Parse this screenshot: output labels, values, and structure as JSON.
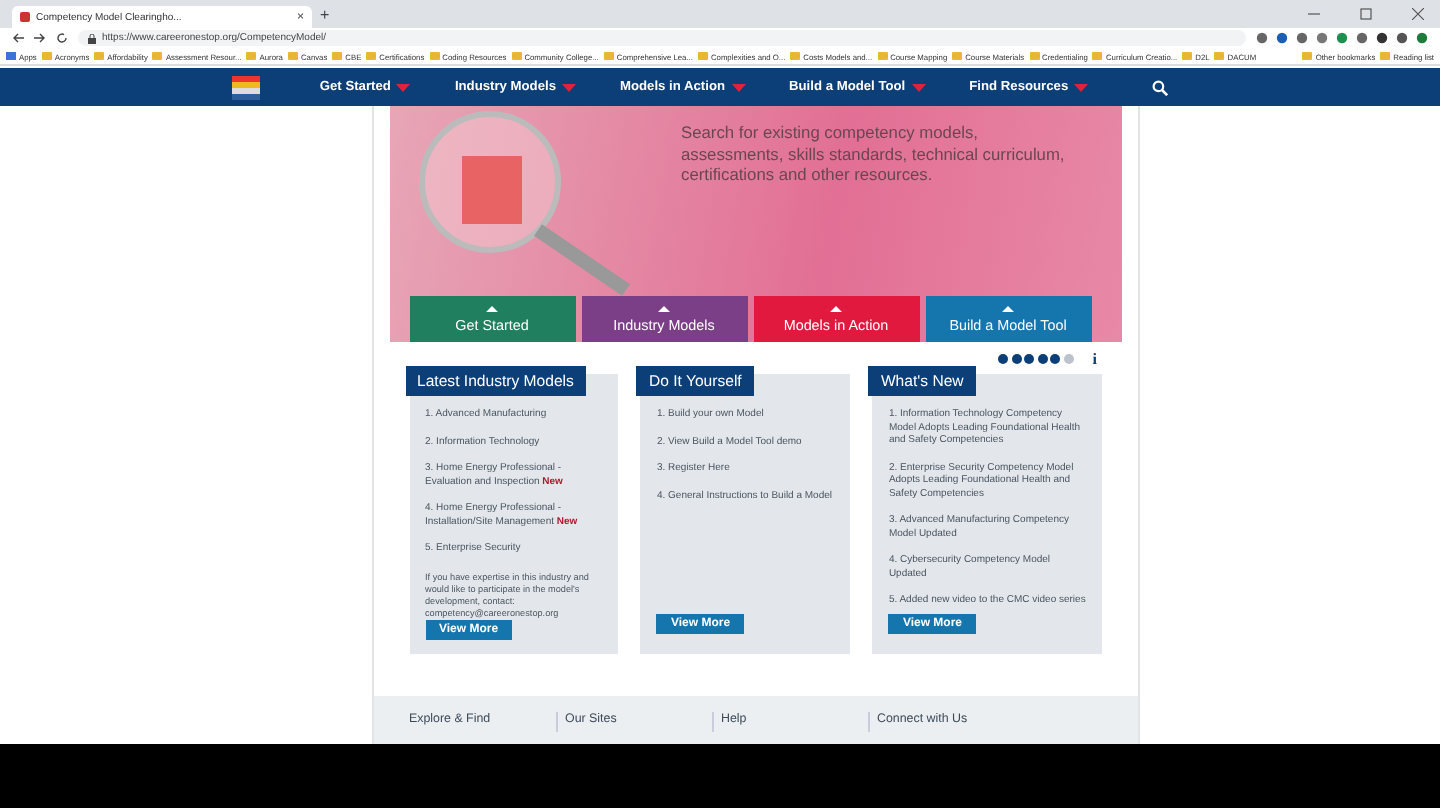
{
  "browser": {
    "tab_title": "Competency Model Clearingho...",
    "tab_close": "×",
    "new_tab": "+",
    "url": "https://www.careeronestop.org/CompetencyModel/",
    "bookmarks": [
      "Apps",
      "Acronyms",
      "Affordability",
      "Assessment Resour...",
      "Aurora",
      "Canvas",
      "CBE",
      "Certifications",
      "Coding Resources",
      "Community College...",
      "Comprehensive Lea...",
      "Complexities and O...",
      "Costs Models and...",
      "Course Mapping",
      "Course Materials",
      "Credentialing",
      "Curriculum Creatio...",
      "D2L",
      "DACUM"
    ],
    "other_bookmarks": [
      "Other bookmarks",
      "Reading list"
    ]
  },
  "nav": {
    "items": [
      "Get Started",
      "Industry Models",
      "Models in Action",
      "Build a Model Tool",
      "Find Resources"
    ]
  },
  "hero": {
    "text": "Search for existing competency models, assessments, skills standards, technical curriculum, certifications and other resources.",
    "tabs": [
      {
        "label": "Get Started",
        "color": "#1f7f5e"
      },
      {
        "label": "Industry Models",
        "color": "#7a3f86"
      },
      {
        "label": "Models in Action",
        "color": "#e2193f"
      },
      {
        "label": "Build a Model Tool",
        "color": "#1576ae"
      }
    ],
    "dots": [
      {
        "selected": false
      },
      {
        "selected": false
      },
      {
        "selected": false
      },
      {
        "selected": false
      },
      {
        "selected": false
      },
      {
        "selected": true
      }
    ],
    "info": "i"
  },
  "cards": [
    {
      "title": "Latest Industry Models",
      "items": [
        {
          "text": "1. Advanced Manufacturing"
        },
        {
          "text": "2. Information Technology"
        },
        {
          "text": "3. Home Energy Professional - Evaluation and Inspection",
          "badge": "New"
        },
        {
          "text": "4. Home Energy Professional - Installation/Site Management",
          "badge": "New"
        },
        {
          "text": "5. Enterprise Security"
        }
      ],
      "note": "If you have expertise in this industry and would like to participate in the model's development, contact: competency@careeronestop.org",
      "button": "View More"
    },
    {
      "title": "Do It Yourself",
      "items": [
        {
          "text": "1. Build your own Model"
        },
        {
          "text": "2. View Build a Model Tool demo"
        },
        {
          "text": "3. Register Here"
        },
        {
          "text": "4. General Instructions to Build a Model"
        }
      ],
      "button": "View More"
    },
    {
      "title": "What's New",
      "items": [
        {
          "text": "1. Information Technology Competency Model Adopts Leading Foundational Health and Safety Competencies"
        },
        {
          "text": "2. Enterprise Security Competency Model Adopts Leading Foundational Health and Safety Competencies"
        },
        {
          "text": "3. Advanced Manufacturing Competency Model Updated"
        },
        {
          "text": "4. Cybersecurity Competency Model Updated"
        },
        {
          "text": "5. Added new video to the CMC video series"
        }
      ],
      "button": "View More"
    }
  ],
  "footer": {
    "columns": [
      "Explore & Find",
      "Our Sites",
      "Help",
      "Connect with Us"
    ]
  }
}
